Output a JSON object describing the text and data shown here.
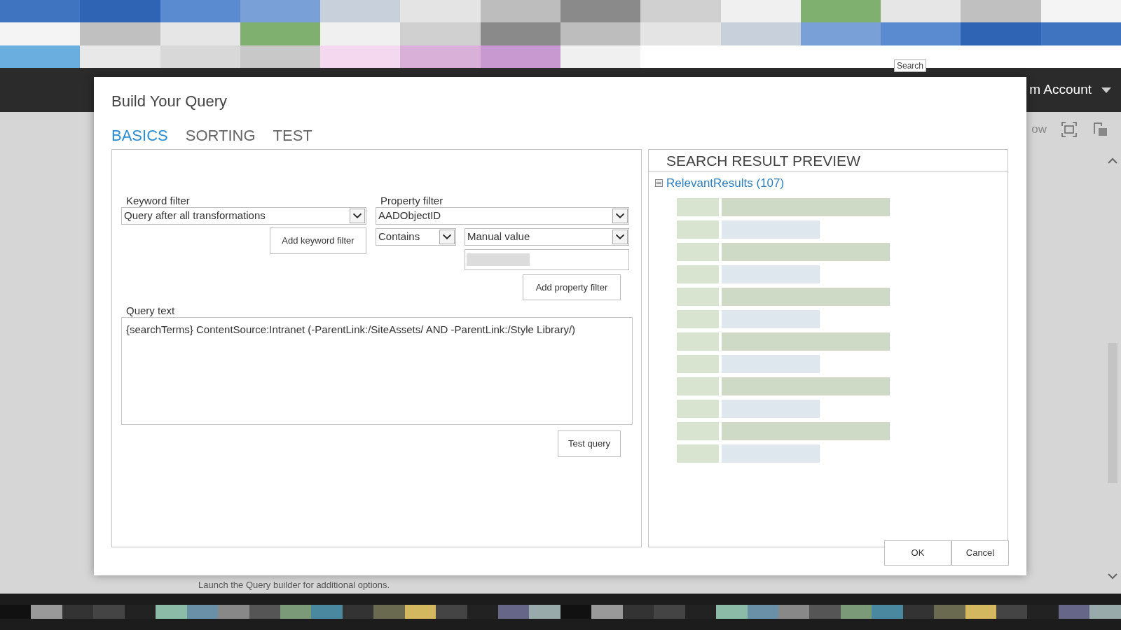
{
  "page": {
    "search_tooltip": "Search",
    "account": "m Account",
    "ribbon_text": "ow",
    "footer_text": "Launch the Query builder for additional options."
  },
  "dialog": {
    "title": "Build Your Query",
    "tabs": [
      {
        "label": "BASICS",
        "selected": true
      },
      {
        "label": "SORTING",
        "selected": false
      },
      {
        "label": "TEST",
        "selected": false
      }
    ],
    "keyword_filter": {
      "label": "Keyword filter",
      "value": "Query after all transformations",
      "button": "Add keyword filter"
    },
    "property_filter": {
      "label": "Property filter",
      "property": "AADObjectID",
      "operator": "Contains",
      "value_source": "Manual value",
      "button": "Add property filter"
    },
    "query_text": {
      "label": "Query text",
      "value": "{searchTerms} ContentSource:Intranet (-ParentLink:/SiteAssets/ AND -ParentLink:/Style Library/)"
    },
    "test_button": "Test query",
    "preview": {
      "title": "SEARCH RESULT PREVIEW",
      "group": {
        "label": "RelevantResults (107)",
        "expanded": true
      }
    },
    "buttons": [
      "OK",
      "Cancel"
    ]
  }
}
